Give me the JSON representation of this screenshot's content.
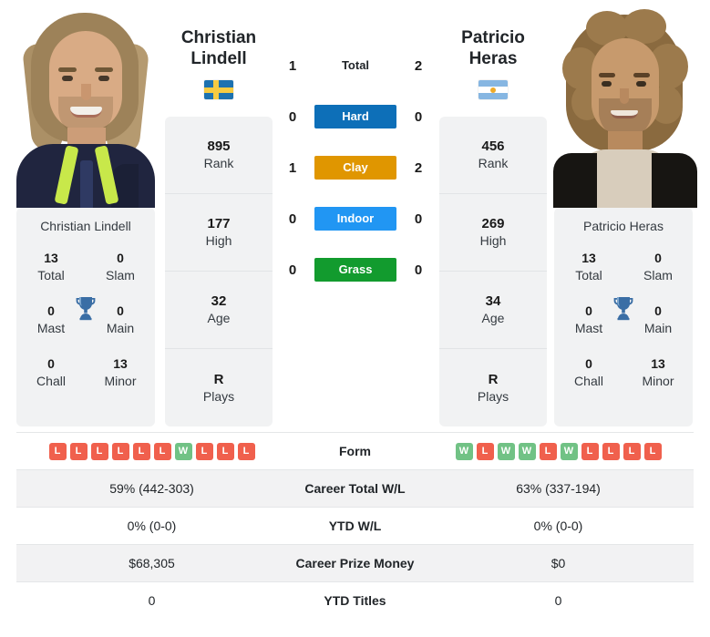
{
  "players": {
    "left": {
      "name_line1": "Christian",
      "name_line2": "Lindell",
      "full_name": "Christian Lindell",
      "flag": "sweden-flag",
      "rank": "895",
      "rank_label": "Rank",
      "high": "177",
      "high_label": "High",
      "age": "32",
      "age_label": "Age",
      "plays": "R",
      "plays_label": "Plays",
      "titles": {
        "total": "13",
        "total_label": "Total",
        "slam": "0",
        "slam_label": "Slam",
        "mast": "0",
        "mast_label": "Mast",
        "main": "0",
        "main_label": "Main",
        "chall": "0",
        "chall_label": "Chall",
        "minor": "13",
        "minor_label": "Minor"
      },
      "form": [
        "L",
        "L",
        "L",
        "L",
        "L",
        "L",
        "W",
        "L",
        "L",
        "L"
      ],
      "career_wl": "59% (442-303)",
      "ytd_wl": "0% (0-0)",
      "prize_money": "$68,305",
      "ytd_titles": "0"
    },
    "right": {
      "name_line1": "Patricio",
      "name_line2": "Heras",
      "full_name": "Patricio Heras",
      "flag": "argentina-flag",
      "rank": "456",
      "rank_label": "Rank",
      "high": "269",
      "high_label": "High",
      "age": "34",
      "age_label": "Age",
      "plays": "R",
      "plays_label": "Plays",
      "titles": {
        "total": "13",
        "total_label": "Total",
        "slam": "0",
        "slam_label": "Slam",
        "mast": "0",
        "mast_label": "Mast",
        "main": "0",
        "main_label": "Main",
        "chall": "0",
        "chall_label": "Chall",
        "minor": "13",
        "minor_label": "Minor"
      },
      "form": [
        "W",
        "L",
        "W",
        "W",
        "L",
        "W",
        "L",
        "L",
        "L",
        "L"
      ],
      "career_wl": "63% (337-194)",
      "ytd_wl": "0% (0-0)",
      "prize_money": "$0",
      "ytd_titles": "0"
    }
  },
  "head_to_head": [
    {
      "label": "Total",
      "left": "1",
      "right": "2",
      "color": "none",
      "pill": false
    },
    {
      "label": "Hard",
      "left": "0",
      "right": "0",
      "color": "#0d6fb8",
      "pill": true
    },
    {
      "label": "Clay",
      "left": "1",
      "right": "2",
      "color": "#e09600",
      "pill": true
    },
    {
      "label": "Indoor",
      "left": "0",
      "right": "0",
      "color": "#2196f3",
      "pill": true
    },
    {
      "label": "Grass",
      "left": "0",
      "right": "0",
      "color": "#129b2e",
      "pill": true
    }
  ],
  "table": {
    "rows": [
      {
        "label": "Form",
        "left": "",
        "right": "",
        "type": "form",
        "shaded": false
      },
      {
        "label": "Career Total W/L",
        "left": "59% (442-303)",
        "right": "63% (337-194)",
        "type": "text",
        "shaded": true
      },
      {
        "label": "YTD W/L",
        "left": "0% (0-0)",
        "right": "0% (0-0)",
        "type": "text",
        "shaded": false
      },
      {
        "label": "Career Prize Money",
        "left": "$68,305",
        "right": "$0",
        "type": "text",
        "shaded": true
      },
      {
        "label": "YTD Titles",
        "left": "0",
        "right": "0",
        "type": "text",
        "shaded": false
      }
    ]
  },
  "colors": {
    "hard": "#0d6fb8",
    "clay": "#e09600",
    "indoor": "#2196f3",
    "grass": "#129b2e",
    "win": "#71c285",
    "loss": "#f0604d",
    "trophy": "#3a6ea5",
    "card_bg": "#f1f2f3"
  }
}
